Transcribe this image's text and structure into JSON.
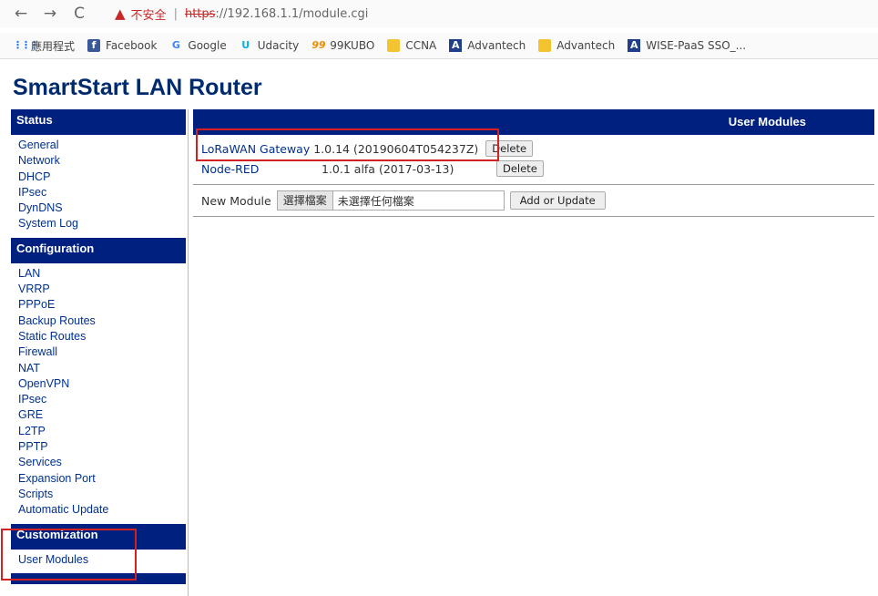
{
  "browser": {
    "back": "←",
    "forward": "→",
    "reload": "C",
    "insecure_label": "不安全",
    "url_scheme": "https",
    "url_rest": "://192.168.1.1/module.cgi"
  },
  "bookmarks": [
    {
      "icon": "apps-icon",
      "label": "應用程式"
    },
    {
      "icon": "facebook-icon",
      "label": "Facebook"
    },
    {
      "icon": "google-icon",
      "label": "Google"
    },
    {
      "icon": "udacity-icon",
      "label": "Udacity"
    },
    {
      "icon": "99kubo-icon",
      "label": "99KUBO"
    },
    {
      "icon": "folder-icon",
      "label": "CCNA"
    },
    {
      "icon": "advantech-icon",
      "label": "Advantech"
    },
    {
      "icon": "folder-icon",
      "label": "Advantech"
    },
    {
      "icon": "wise-icon",
      "label": "WISE-PaaS SSO_..."
    }
  ],
  "page_title": "SmartStart LAN Router",
  "sidebar": {
    "status": {
      "title": "Status",
      "items": [
        "General",
        "Network",
        "DHCP",
        "IPsec",
        "DynDNS",
        "System Log"
      ]
    },
    "configuration": {
      "title": "Configuration",
      "items": [
        "LAN",
        "VRRP",
        "PPPoE",
        "Backup Routes",
        "Static Routes",
        "Firewall",
        "NAT",
        "OpenVPN",
        "IPsec",
        "GRE",
        "L2TP",
        "PPTP",
        "Services",
        "Expansion Port",
        "Scripts",
        "Automatic Update"
      ]
    },
    "customization": {
      "title": "Customization",
      "items": [
        "User Modules"
      ]
    }
  },
  "main": {
    "header": "User Modules",
    "modules": [
      {
        "name": "LoRaWAN Gateway",
        "version": "1.0.14 (20190604T054237Z)",
        "delete": "Delete"
      },
      {
        "name": "Node-RED",
        "version": "1.0.1 alfa (2017-03-13)",
        "delete": "Delete"
      }
    ],
    "new_module_label": "New Module",
    "choose_file": "選擇檔案",
    "no_file": "未選擇任何檔案",
    "add_button": "Add or Update"
  },
  "colors": {
    "header_bg": "#002080",
    "link": "#00308f",
    "highlight": "#d32020"
  }
}
